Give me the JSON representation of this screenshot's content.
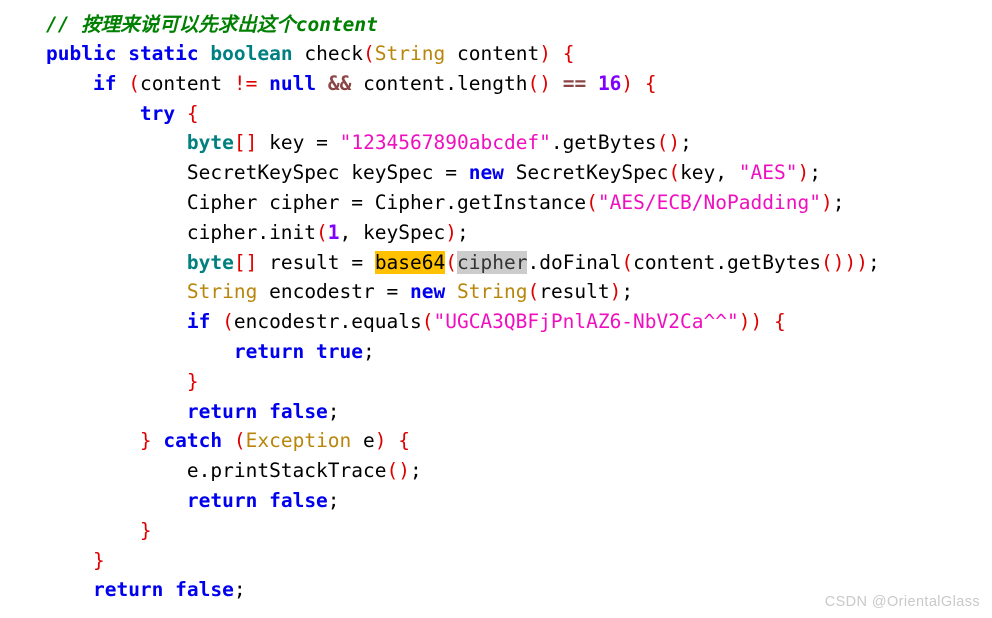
{
  "document": {
    "kind": "java-source-code-screenshot",
    "language": "Java",
    "background_color": "#ffffff"
  },
  "theme": {
    "comment_color": "#008000",
    "keyword_color": "#0000ee",
    "type_color": "#008080",
    "classname_color": "#b8860b",
    "string_color": "#ef0fbf",
    "paren_color": "#dd0000",
    "number_color": "#8000ff",
    "operator_color": "#8b4545",
    "plain_color": "#000000",
    "highlight_yellow": "#ffc000",
    "highlight_gray": "#cccccc",
    "watermark_color": "#c9c9c9"
  },
  "lines": {
    "l1": {
      "comment": "// 按理来说可以先求出这个content"
    },
    "l2": {
      "kw_public": "public",
      "sp1": " ",
      "kw_static": "static",
      "sp2": " ",
      "type_boolean": "boolean",
      "sp3": " ",
      "name_check": "check",
      "paren_open": "(",
      "cls_String": "String",
      "sp4": " ",
      "arg_content": "content",
      "paren_close": ")",
      "sp5": " ",
      "brace_open": "{"
    },
    "l3": {
      "indent": "    ",
      "kw_if": "if",
      "sp1": " ",
      "paren_open": "(",
      "var_content": "content",
      "sp2": " ",
      "op_neq": "!=",
      "sp3": " ",
      "kw_null": "null",
      "sp4": " ",
      "op_and": "&&",
      "sp5": " ",
      "expr_len": "content.length",
      "paren2_open": "(",
      "paren2_close": ")",
      "sp6": " ",
      "op_eq": "==",
      "sp7": " ",
      "num_16": "16",
      "paren_close": ")",
      "sp8": " ",
      "brace_open": "{"
    },
    "l4": {
      "indent": "        ",
      "kw_try": "try",
      "sp1": " ",
      "brace_open": "{"
    },
    "l5": {
      "indent": "            ",
      "type_byte": "byte",
      "brk_open": "[",
      "brk_close": "]",
      "sp1": " ",
      "var_key": "key",
      "sp2": " ",
      "op_assign": "=",
      "sp3": " ",
      "str_key": "\"1234567890abcdef\"",
      "call_getBytes": ".getBytes",
      "paren_open": "(",
      "paren_close": ")",
      "semi": ";"
    },
    "l6": {
      "indent": "            ",
      "cls_SecretKeySpec": "SecretKeySpec",
      "sp1": " ",
      "var_keySpec": "keySpec",
      "sp2": " ",
      "op_assign": "=",
      "sp3": " ",
      "kw_new": "new",
      "sp4": " ",
      "ctor_SecretKeySpec": "SecretKeySpec",
      "paren_open": "(",
      "arg_key": "key,",
      "sp5": " ",
      "str_AES": "\"AES\"",
      "paren_close": ")",
      "semi": ";"
    },
    "l7": {
      "indent": "            ",
      "cls_Cipher": "Cipher",
      "sp1": " ",
      "var_cipher": "cipher",
      "sp2": " ",
      "op_assign": "=",
      "sp3": " ",
      "call_getInstance": "Cipher.getInstance",
      "paren_open": "(",
      "str_transform": "\"AES/ECB/NoPadding\"",
      "paren_close": ")",
      "semi": ";"
    },
    "l8": {
      "indent": "            ",
      "call_init": "cipher.init",
      "paren_open": "(",
      "num_1": "1",
      "comma": ",",
      "sp1": " ",
      "arg_keySpec": "keySpec",
      "paren_close": ")",
      "semi": ";"
    },
    "l9": {
      "indent": "            ",
      "type_byte": "byte",
      "brk_open": "[",
      "brk_close": "]",
      "sp1": " ",
      "var_result": "result",
      "sp2": " ",
      "op_assign": "=",
      "sp3": " ",
      "hl_base64": "base64",
      "paren_open": "(",
      "hl_cipher": "cipher",
      "rest": ".doFinal",
      "paren2_open": "(",
      "arg_content": "content.getBytes",
      "paren3_open": "(",
      "paren3_close": ")",
      "paren2_close": ")",
      "paren_close": ")",
      "semi": ";"
    },
    "l10": {
      "indent": "            ",
      "cls_String": "String",
      "sp1": " ",
      "var_encodestr": "encodestr",
      "sp2": " ",
      "op_assign": "=",
      "sp3": " ",
      "kw_new": "new",
      "sp4": " ",
      "ctor_String": "String",
      "paren_open": "(",
      "arg_result": "result",
      "paren_close": ")",
      "semi": ";"
    },
    "l11": {
      "indent": "            ",
      "kw_if": "if",
      "sp1": " ",
      "paren_open": "(",
      "call_equals": "encodestr.equals",
      "paren2_open": "(",
      "str_target": "\"UGCA3QBFjPnlAZ6-NbV2Ca^^\"",
      "paren2_close": ")",
      "paren_close": ")",
      "sp2": " ",
      "brace_open": "{"
    },
    "l12": {
      "indent": "                ",
      "kw_return": "return",
      "sp1": " ",
      "kw_true": "true",
      "semi": ";"
    },
    "l13": {
      "indent": "            ",
      "brace_close": "}"
    },
    "l14": {
      "indent": "            ",
      "kw_return": "return",
      "sp1": " ",
      "kw_false": "false",
      "semi": ";"
    },
    "l15": {
      "indent": "        ",
      "brace_close": "}",
      "sp1": " ",
      "kw_catch": "catch",
      "sp2": " ",
      "paren_open": "(",
      "cls_Exception": "Exception",
      "sp3": " ",
      "var_e": "e",
      "paren_close": ")",
      "sp4": " ",
      "brace_open": "{"
    },
    "l16": {
      "indent": "            ",
      "call_printStackTrace": "e.printStackTrace",
      "paren_open": "(",
      "paren_close": ")",
      "semi": ";"
    },
    "l17": {
      "indent": "            ",
      "kw_return": "return",
      "sp1": " ",
      "kw_false": "false",
      "semi": ";"
    },
    "l18": {
      "indent": "        ",
      "brace_close": "}"
    },
    "l19": {
      "indent": "    ",
      "brace_close": "}"
    },
    "l20": {
      "indent": "    ",
      "kw_return": "return",
      "sp1": " ",
      "kw_false": "false",
      "semi": ";"
    }
  },
  "watermark": {
    "text": "CSDN @OrientalGlass"
  }
}
